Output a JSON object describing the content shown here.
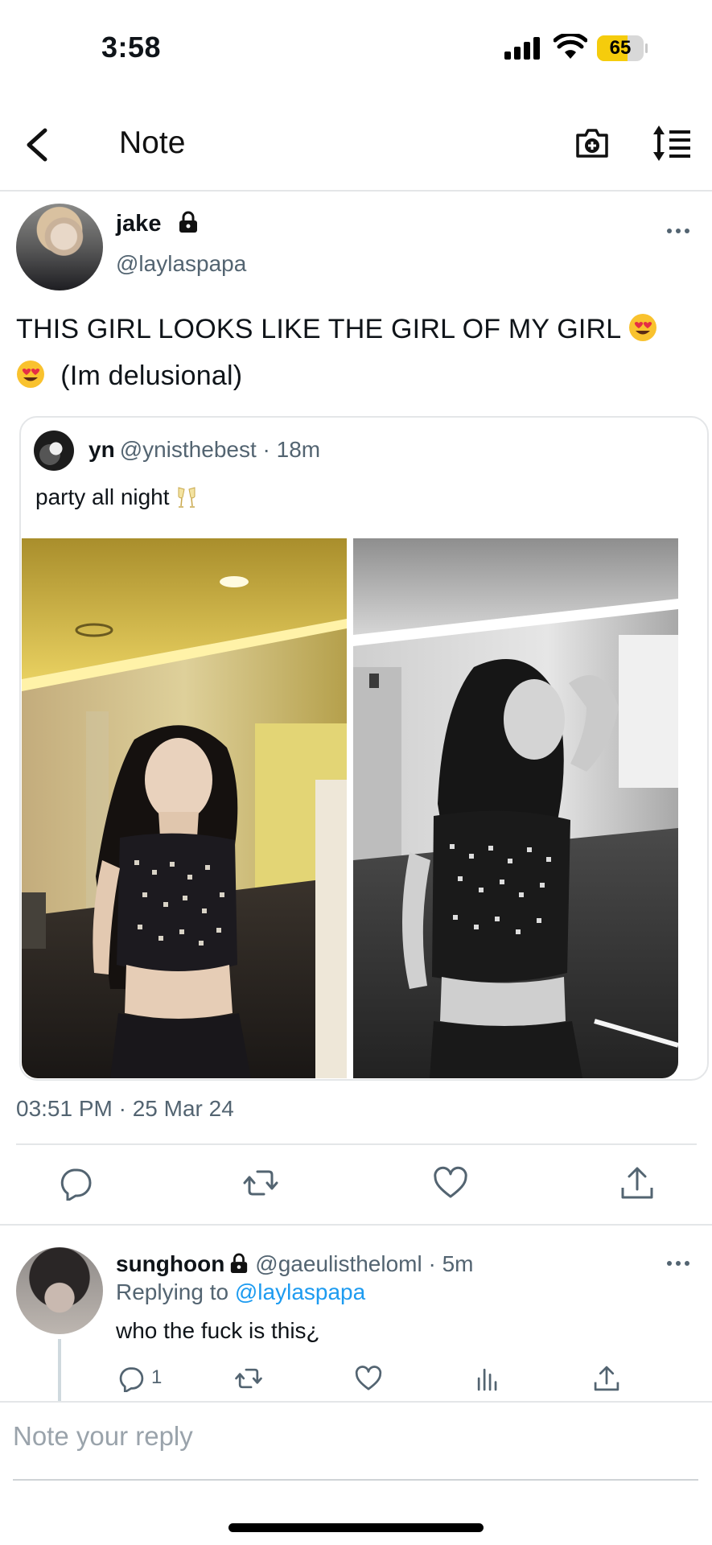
{
  "status_bar": {
    "time": "3:58",
    "battery": "65",
    "battery_level": 0.65,
    "battery_color": "#f5cc0c"
  },
  "nav": {
    "title": "Note",
    "back_icon": "chevron-left-icon",
    "camera_icon": "camera-plus-icon",
    "sort_icon": "sort-icon"
  },
  "tweet": {
    "author_name": "jake",
    "author_handle": "@laylaspapa",
    "text_line1": "THIS GIRL LOOKS LIKE THE GIRL OF MY GIRL",
    "text_line2": "(Im delusional)",
    "emoji": "heart-eyes-emoji",
    "timestamp": "03:51 PM · 25 Mar 24"
  },
  "quote": {
    "name": "yn",
    "meta": "@ynisthebest · 18m",
    "text": "party all night",
    "emoji": "clinking-glasses-emoji"
  },
  "actions": [
    "reply-icon",
    "retweet-icon",
    "like-icon",
    "share-icon"
  ],
  "reply": {
    "author_name": "sunghoon",
    "meta": "@gaeulistheloml · 5m",
    "replying_prefix": "Replying to",
    "replying_handle": "@laylaspapa",
    "text": "who the fuck is this¿",
    "reply_count": "1"
  },
  "compose": {
    "placeholder": "Note your reply"
  },
  "colors": {
    "accent": "#1d9bf0",
    "secondary_text": "#536471"
  }
}
